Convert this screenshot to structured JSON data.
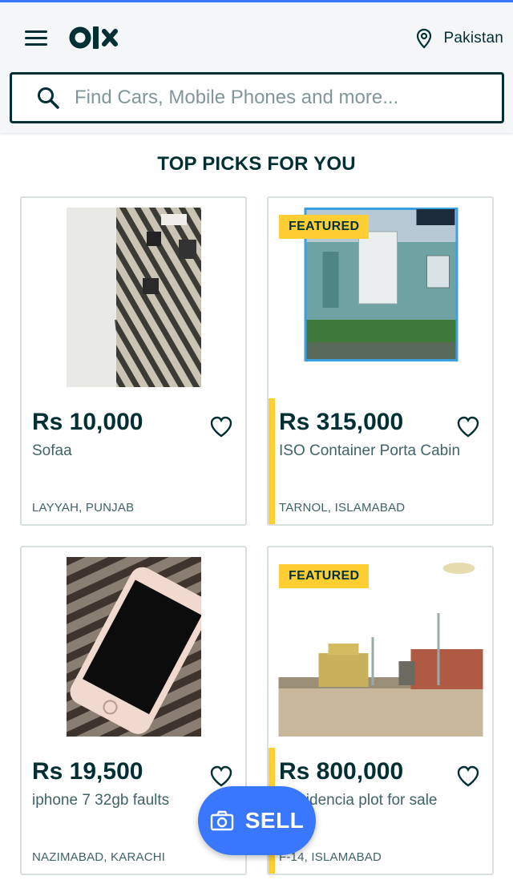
{
  "header": {
    "logo_text": "olx",
    "location": "Pakistan"
  },
  "search": {
    "placeholder": "Find Cars, Mobile Phones and more..."
  },
  "section_title": "TOP PICKS FOR YOU",
  "listings": [
    {
      "price": "Rs 10,000",
      "title": "Sofaa",
      "location": "LAYYAH, PUNJAB",
      "featured": false
    },
    {
      "price": "Rs 315,000",
      "title": "ISO Container Porta Cabin",
      "location": "TARNOL, ISLAMABAD",
      "featured": true,
      "badge": "FEATURED"
    },
    {
      "price": "Rs 19,500",
      "title": "iphone 7 32gb faults",
      "location": "NAZIMABAD, KARACHI",
      "featured": false
    },
    {
      "price": "Rs 800,000",
      "title": "Residencia plot for sale",
      "location": "F-14, ISLAMABAD",
      "featured": true,
      "badge": "FEATURED"
    }
  ],
  "sell_button": {
    "label": "SELL"
  },
  "colors": {
    "brand": "#002f34",
    "accent": "#3a77ff",
    "featured": "#ffce32"
  }
}
